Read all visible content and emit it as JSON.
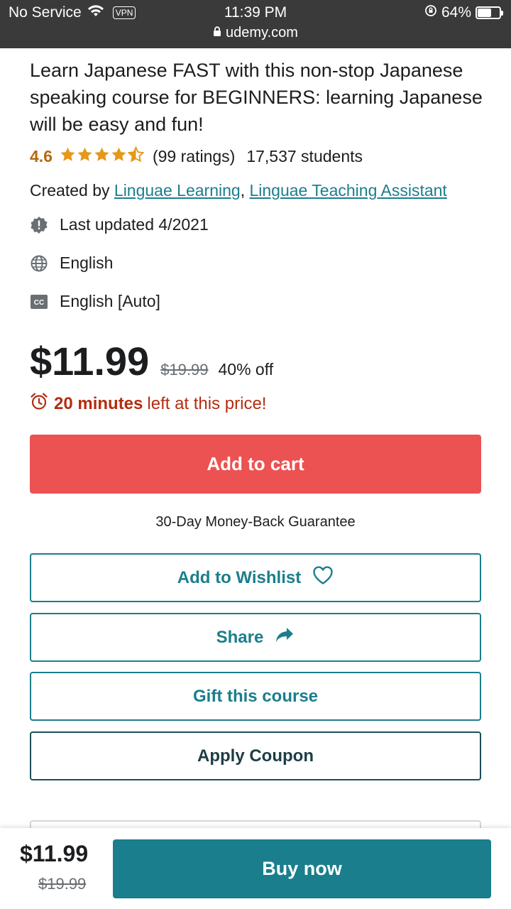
{
  "status_bar": {
    "carrier": "No Service",
    "vpn": "VPN",
    "time": "11:39 PM",
    "battery": "64%",
    "battery_level": 0.64,
    "url": "udemy.com"
  },
  "course": {
    "subtitle": "Learn Japanese FAST with this non-stop Japanese speaking course for BEGINNERS: learning Japanese will be easy and fun!",
    "rating": "4.6",
    "rating_value": 4.6,
    "ratings_count": "(99 ratings)",
    "students": "17,537 students",
    "created_by_label": "Created by",
    "authors": [
      "Linguae Learning",
      "Linguae Teaching Assistant"
    ],
    "last_updated": "Last updated 4/2021",
    "language": "English",
    "captions": "English [Auto]"
  },
  "pricing": {
    "current_price": "$11.99",
    "original_price": "$19.99",
    "discount": "40% off",
    "timer_bold": "20 minutes",
    "timer_rest": "left at this price!"
  },
  "actions": {
    "add_to_cart": "Add to cart",
    "guarantee": "30-Day Money-Back Guarantee",
    "wishlist": "Add to Wishlist",
    "share": "Share",
    "gift": "Gift this course",
    "coupon": "Apply Coupon"
  },
  "bottom_bar": {
    "price": "$11.99",
    "original_price": "$19.99",
    "buy_now": "Buy now"
  },
  "colors": {
    "accent_teal": "#1b7e8c",
    "cart_red": "#ec5252",
    "star_orange": "#e59819",
    "timer_red": "#b32d0f",
    "status_bar_bg": "#3a3a3a"
  }
}
